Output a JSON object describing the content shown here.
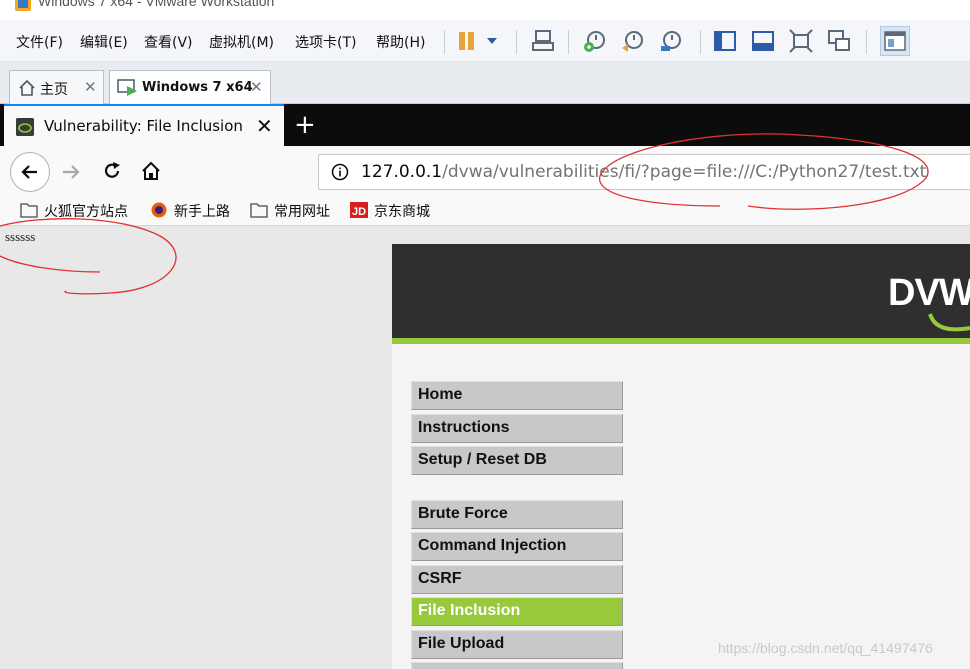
{
  "vmware": {
    "title": "Windows 7 x64 - VMware Workstation",
    "menu": [
      "文件(F)",
      "编辑(E)",
      "查看(V)",
      "虚拟机(M)",
      "选项卡(T)",
      "帮助(H)"
    ],
    "toolbar_icons": [
      "pause-icon",
      "dropdown-arrow-icon",
      "send-ctrl-alt-del-icon",
      "snapshot-take-icon",
      "snapshot-revert-icon",
      "snapshot-manager-icon",
      "console-view-icon",
      "thumbnail-view-icon",
      "fullscreen-icon",
      "unity-icon",
      "library-view-icon"
    ],
    "tabs": [
      {
        "label": "主页",
        "icon": "home-icon"
      },
      {
        "label": "Windows 7 x64",
        "icon": "vm-icon"
      }
    ],
    "accent": "#1c6fb8"
  },
  "firefox": {
    "tab_title": "Vulnerability: File Inclusion ::",
    "new_tab": "+",
    "url_host": "127.0.0.1",
    "url_rest": "/dvwa/vulnerabilities/fi/?page=file:///C:/Python27/test.txt",
    "bookmarks": [
      {
        "label": "火狐官方站点",
        "icon": "folder-icon"
      },
      {
        "label": "新手上路",
        "icon": "firefox-icon"
      },
      {
        "label": "常用网址",
        "icon": "folder-icon"
      },
      {
        "label": "京东商城",
        "icon": "jd-icon"
      }
    ],
    "accent": "#0a84ff"
  },
  "page": {
    "included_text": "ssssss",
    "logo": "DVW",
    "menu_group1": [
      "Home",
      "Instructions",
      "Setup / Reset DB"
    ],
    "menu_group2": [
      "Brute Force",
      "Command Injection",
      "CSRF",
      "File Inclusion",
      "File Upload"
    ],
    "selected": "File Inclusion",
    "dvwa_green": "#98c93c"
  },
  "watermark": "https://blog.csdn.net/qq_41497476",
  "annotation_color": "#e03030"
}
